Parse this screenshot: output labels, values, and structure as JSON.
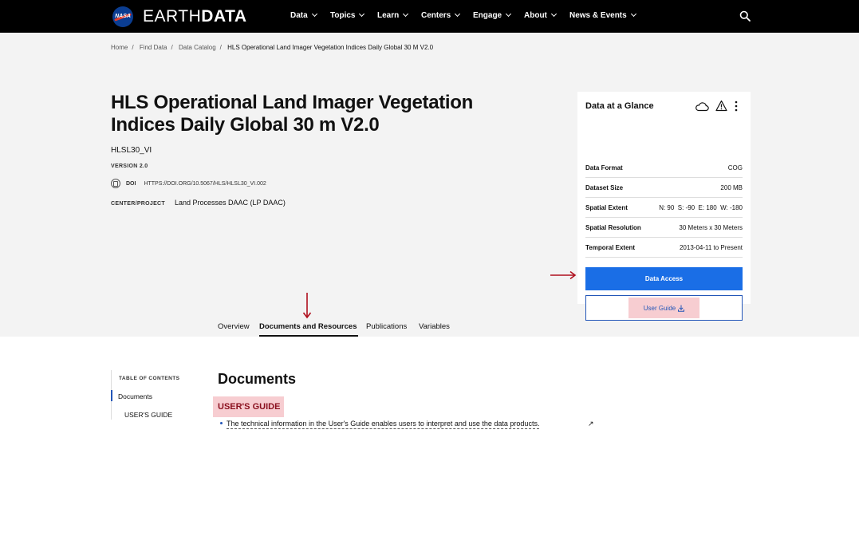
{
  "nav": {
    "logo": "NASA",
    "brand_light": "EARTH",
    "brand_bold": "DATA",
    "items": [
      "Data",
      "Topics",
      "Learn",
      "Centers",
      "Engage",
      "About",
      "News & Events"
    ]
  },
  "breadcrumb": [
    "Home",
    "Find Data",
    "Data Catalog",
    "HLS Operational Land Imager Vegetation Indices Daily Global 30 M V2.0"
  ],
  "dataset": {
    "title": "HLS Operational Land Imager Vegetation Indices Daily Global 30 m V2.0",
    "short_name": "HLSL30_VI",
    "version": "VERSION 2.0",
    "doi_label": "DOI",
    "doi_value": "HTTPS://DOI.ORG/10.5067/HLS/HLSL30_VI.002",
    "center_label": "CENTER/PROJECT",
    "center_value": "Land Processes DAAC (LP DAAC)"
  },
  "glance": {
    "title": "Data at a Glance",
    "rows": [
      {
        "label": "Data Format",
        "value": "COG"
      },
      {
        "label": "Dataset Size",
        "value": "200 MB"
      },
      {
        "label": "Spatial Extent",
        "value": "N: 90  S: -90  E: 180  W: -180"
      },
      {
        "label": "Spatial Resolution",
        "value": "30 Meters x 30 Meters"
      },
      {
        "label": "Temporal Extent",
        "value": "2013-04-11 to Present"
      }
    ],
    "access_button": "Data Access",
    "guide_button": "User Guide"
  },
  "tabs": [
    "Overview",
    "Documents and Resources",
    "Publications",
    "Variables"
  ],
  "toc": {
    "title": "TABLE OF CONTENTS",
    "items": [
      "Documents",
      "USER'S GUIDE"
    ]
  },
  "documents": {
    "heading": "Documents",
    "section": "USER'S GUIDE",
    "item": "The technical information in the User's Guide enables users to interpret and use the data products."
  },
  "colors": {
    "nav_bg": "#000000",
    "accent_blue": "#1a6ee6",
    "highlight": "#f7cdd1",
    "annotation_red": "#b0101e"
  }
}
